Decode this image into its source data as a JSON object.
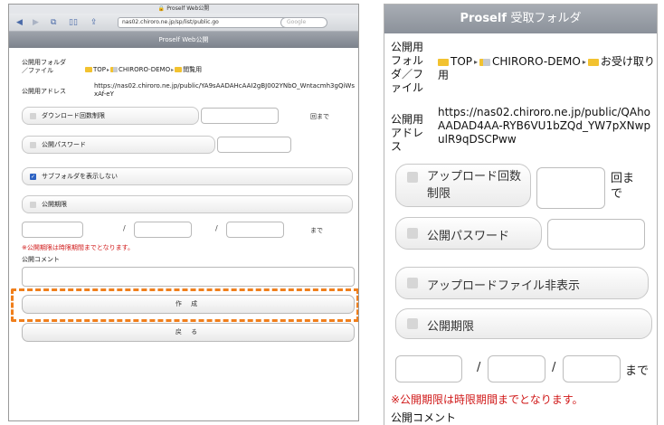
{
  "left": {
    "status_title": "Proself Web公開",
    "address": "nas02.chiroro.ne.jp/sp/list/public.go",
    "search_placeholder": "Google",
    "page_title": "Proself Web公開",
    "folder_label": "公開用フォルダ／ファイル",
    "breadcrumb": [
      "TOP",
      "CHIRORO-DEMO",
      "閲覧用"
    ],
    "address_label": "公開用アドレス",
    "address_value": "https://nas02.chiroro.ne.jp/public/YA9sAADAHcAAI2gBJ002YNbO_Wntacmh3gQiWsxAf-eY",
    "download_limit_label": "ダウンロード回数制限",
    "times_suffix": "回まで",
    "password_label": "公開パスワード",
    "subfolder_label": "サブフォルダを表示しない",
    "period_label": "公開期限",
    "slash": "/",
    "until": "まで",
    "period_note": "※公開期限は時限期間までとなります。",
    "comment_label": "公開コメント",
    "create_button": "作 成",
    "back_button": "戻 る"
  },
  "right": {
    "page_title": "Proself",
    "page_title_sub": "受取フォルダ",
    "folder_label": "公開用フォルダ／ファイル",
    "breadcrumb": [
      "TOP",
      "CHIRORO-DEMO",
      "お受け取り用"
    ],
    "address_label": "公開用アドレス",
    "address_value": "https://nas02.chiroro.ne.jp/public/QAhoAADAD4AA-RYB6VU1bZQd_YW7pXNwpulR9qDSCPww",
    "upload_limit_label": "アップロード回数制限",
    "times_suffix": "回まで",
    "password_label": "公開パスワード",
    "hide_upload_label": "アップロードファイル非表示",
    "period_label": "公開期限",
    "slash": "/",
    "until": "まで",
    "period_note": "※公開期限は時限期間までとなります。",
    "comment_label": "公開コメント"
  },
  "colors": {
    "highlight": "#f07f1c",
    "title_bar": "#8b919a",
    "checkbox_on": "#2d62c2",
    "note_red": "#d01818"
  }
}
